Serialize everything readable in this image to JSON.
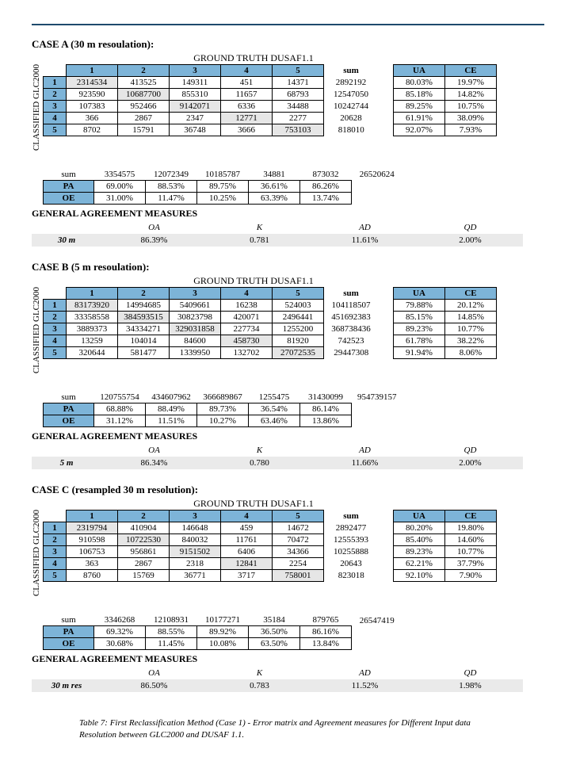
{
  "caption_line1": "Table 7: First Reclassification Method (Case 1) - Error matrix and Agreement measures for Different Input data",
  "caption_line2": "Resolution between GLC2000 and DUSAF 1.1.",
  "cases": [
    {
      "title": "CASE A (30 m resoulation):",
      "gt_title": "GROUND TRUTH DUSAF1.1",
      "axis_label": "CLASSIFIED GLC2000",
      "headers": [
        "1",
        "2",
        "3",
        "4",
        "5"
      ],
      "sum_label": "sum",
      "ua_label": "UA",
      "ce_label": "CE",
      "rows": [
        {
          "h": "1",
          "c": [
            "2314534",
            "413525",
            "149311",
            "451",
            "14371"
          ],
          "sum": "2892192",
          "ua": "80.03%",
          "ce": "19.97%"
        },
        {
          "h": "2",
          "c": [
            "923590",
            "10687700",
            "855310",
            "11657",
            "68793"
          ],
          "sum": "12547050",
          "ua": "85.18%",
          "ce": "14.82%"
        },
        {
          "h": "3",
          "c": [
            "107383",
            "952466",
            "9142071",
            "6336",
            "34488"
          ],
          "sum": "10242744",
          "ua": "89.25%",
          "ce": "10.75%"
        },
        {
          "h": "4",
          "c": [
            "366",
            "2867",
            "2347",
            "12771",
            "2277"
          ],
          "sum": "20628",
          "ua": "61.91%",
          "ce": "38.09%"
        },
        {
          "h": "5",
          "c": [
            "8702",
            "15791",
            "36748",
            "3666",
            "753103"
          ],
          "sum": "818010",
          "ua": "92.07%",
          "ce": "7.93%"
        }
      ],
      "colsum": [
        "3354575",
        "12072349",
        "10185787",
        "34881",
        "873032"
      ],
      "grand": "26520624",
      "pa_label": "PA",
      "oe_label": "OE",
      "pa": [
        "69.00%",
        "88.53%",
        "89.75%",
        "36.61%",
        "86.26%"
      ],
      "oe": [
        "31.00%",
        "11.47%",
        "10.25%",
        "63.39%",
        "13.74%"
      ],
      "gam": "GENERAL AGREEMENT MEASURES",
      "mh": [
        "OA",
        "K",
        "AD",
        "QD"
      ],
      "ml": "30 m",
      "mv": [
        "86.39%",
        "0.781",
        "11.61%",
        "2.00%"
      ]
    },
    {
      "title": "CASE B (5 m resoulation):",
      "gt_title": "GROUND TRUTH DUSAF1.1",
      "axis_label": "CLASSIFIED GLC2000",
      "headers": [
        "1",
        "2",
        "3",
        "4",
        "5"
      ],
      "sum_label": "sum",
      "ua_label": "UA",
      "ce_label": "CE",
      "rows": [
        {
          "h": "1",
          "c": [
            "83173920",
            "14994685",
            "5409661",
            "16238",
            "524003"
          ],
          "sum": "104118507",
          "ua": "79.88%",
          "ce": "20.12%"
        },
        {
          "h": "2",
          "c": [
            "33358558",
            "384593515",
            "30823798",
            "420071",
            "2496441"
          ],
          "sum": "451692383",
          "ua": "85.15%",
          "ce": "14.85%"
        },
        {
          "h": "3",
          "c": [
            "3889373",
            "34334271",
            "329031858",
            "227734",
            "1255200"
          ],
          "sum": "368738436",
          "ua": "89.23%",
          "ce": "10.77%"
        },
        {
          "h": "4",
          "c": [
            "13259",
            "104014",
            "84600",
            "458730",
            "81920"
          ],
          "sum": "742523",
          "ua": "61.78%",
          "ce": "38.22%"
        },
        {
          "h": "5",
          "c": [
            "320644",
            "581477",
            "1339950",
            "132702",
            "27072535"
          ],
          "sum": "29447308",
          "ua": "91.94%",
          "ce": "8.06%"
        }
      ],
      "colsum": [
        "120755754",
        "434607962",
        "366689867",
        "1255475",
        "31430099"
      ],
      "grand": "954739157",
      "pa_label": "PA",
      "oe_label": "OE",
      "pa": [
        "68.88%",
        "88.49%",
        "89.73%",
        "36.54%",
        "86.14%"
      ],
      "oe": [
        "31.12%",
        "11.51%",
        "10.27%",
        "63.46%",
        "13.86%"
      ],
      "gam": "GENERAL AGREEMENT MEASURES",
      "mh": [
        "OA",
        "K",
        "AD",
        "QD"
      ],
      "ml": "5 m",
      "mv": [
        "86.34%",
        "0.780",
        "11.66%",
        "2.00%"
      ]
    },
    {
      "title": "CASE C (resampled 30 m resolution):",
      "gt_title": "GROUND TRUTH DUSAF1.1",
      "axis_label": "CLASSIFIED GLC2000",
      "headers": [
        "1",
        "2",
        "3",
        "4",
        "5"
      ],
      "sum_label": "sum",
      "ua_label": "UA",
      "ce_label": "CE",
      "rows": [
        {
          "h": "1",
          "c": [
            "2319794",
            "410904",
            "146648",
            "459",
            "14672"
          ],
          "sum": "2892477",
          "ua": "80.20%",
          "ce": "19.80%"
        },
        {
          "h": "2",
          "c": [
            "910598",
            "10722530",
            "840032",
            "11761",
            "70472"
          ],
          "sum": "12555393",
          "ua": "85.40%",
          "ce": "14.60%"
        },
        {
          "h": "3",
          "c": [
            "106753",
            "956861",
            "9151502",
            "6406",
            "34366"
          ],
          "sum": "10255888",
          "ua": "89.23%",
          "ce": "10.77%"
        },
        {
          "h": "4",
          "c": [
            "363",
            "2867",
            "2318",
            "12841",
            "2254"
          ],
          "sum": "20643",
          "ua": "62.21%",
          "ce": "37.79%"
        },
        {
          "h": "5",
          "c": [
            "8760",
            "15769",
            "36771",
            "3717",
            "758001"
          ],
          "sum": "823018",
          "ua": "92.10%",
          "ce": "7.90%"
        }
      ],
      "colsum": [
        "3346268",
        "12108931",
        "10177271",
        "35184",
        "879765"
      ],
      "grand": "26547419",
      "pa_label": "PA",
      "oe_label": "OE",
      "pa": [
        "69.32%",
        "88.55%",
        "89.92%",
        "36.50%",
        "86.16%"
      ],
      "oe": [
        "30.68%",
        "11.45%",
        "10.08%",
        "63.50%",
        "13.84%"
      ],
      "gam": "GENERAL AGREEMENT MEASURES",
      "mh": [
        "OA",
        "K",
        "AD",
        "QD"
      ],
      "ml": "30 m res",
      "mv": [
        "86.50%",
        "0.783",
        "11.52%",
        "1.98%"
      ]
    }
  ]
}
